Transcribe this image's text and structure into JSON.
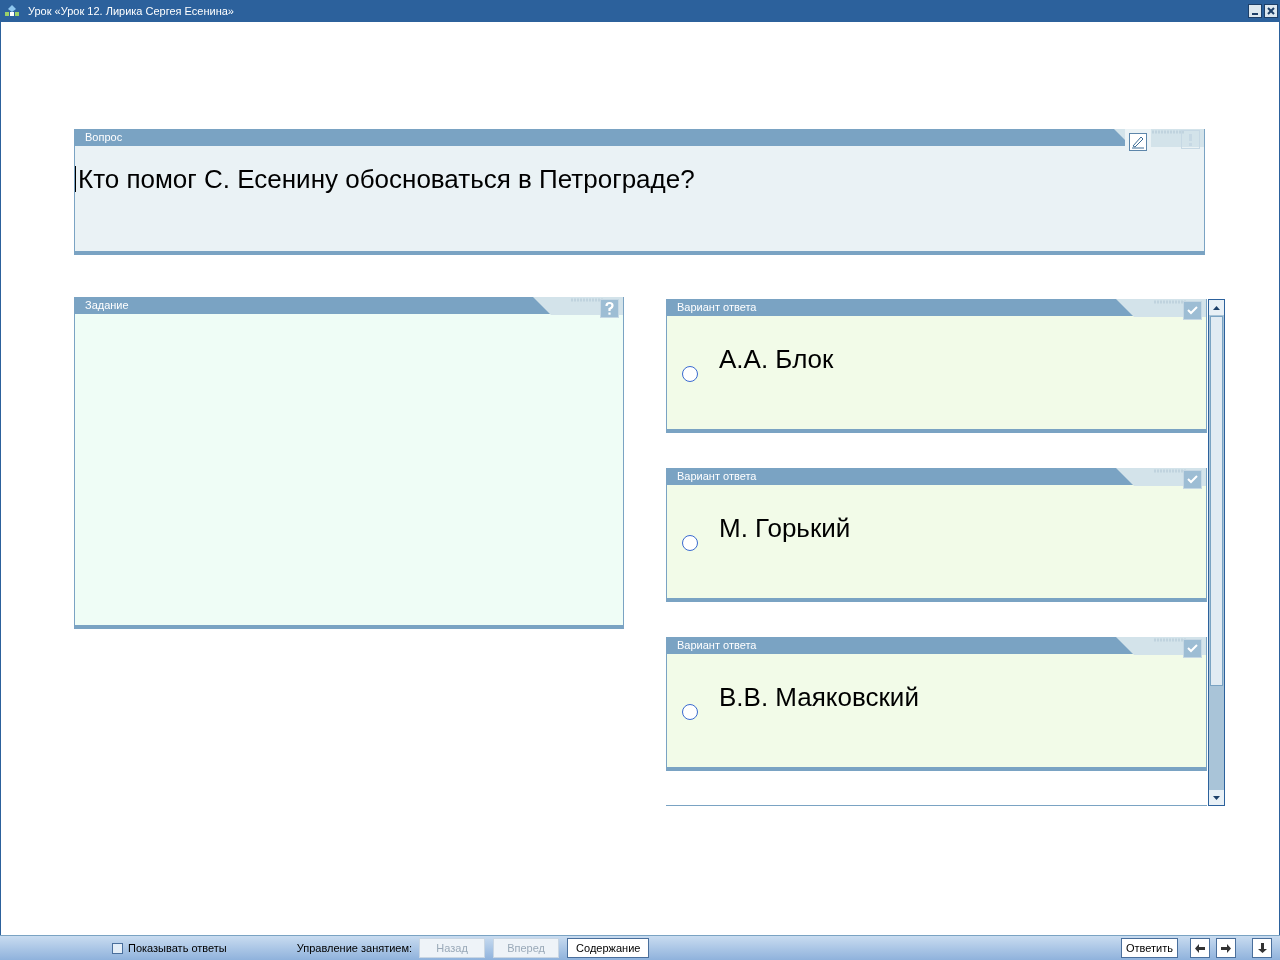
{
  "window": {
    "title": "Урок «Урок 12. Лирика Сергея Есенина»"
  },
  "question": {
    "header": "Вопрос",
    "text": "Кто помог С. Есенину обосноваться в Петрограде?"
  },
  "task": {
    "header": "Задание"
  },
  "answers": [
    {
      "header": "Вариант ответа",
      "text": "А.А. Блок",
      "selected": false
    },
    {
      "header": "Вариант ответа",
      "text": "М. Горький",
      "selected": false
    },
    {
      "header": "Вариант ответа",
      "text": "В.В. Маяковский",
      "selected": false
    }
  ],
  "bottom_bar": {
    "show_answers": {
      "label": "Показывать ответы",
      "checked": false
    },
    "control_label": "Управление занятием:",
    "nav_buttons": [
      {
        "label": "Назад",
        "disabled": true
      },
      {
        "label": "Вперед",
        "disabled": true
      },
      {
        "label": "Содержание",
        "disabled": false
      }
    ],
    "answer_button": {
      "label": "Ответить"
    }
  }
}
